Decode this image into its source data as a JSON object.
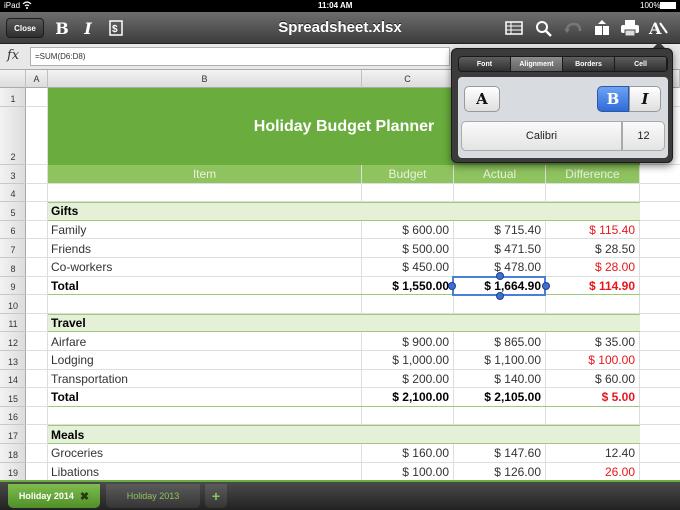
{
  "status": {
    "carrier": "iPad",
    "time": "11:04 AM",
    "battery": "100%"
  },
  "toolbar": {
    "close_label": "Close",
    "bold_label": "B",
    "italic_label": "I",
    "title": "Spreadsheet.xlsx",
    "icons": [
      "format-icon",
      "table-icon",
      "search-icon",
      "undo-icon",
      "insert-icon",
      "print-icon",
      "text-format-icon"
    ]
  },
  "formula": {
    "fx": "fx",
    "value": "=SUM(D6:D8)"
  },
  "columns": [
    "A",
    "B",
    "C"
  ],
  "rows": [
    "1",
    "2",
    "3",
    "4",
    "5",
    "6",
    "7",
    "8",
    "9",
    "10",
    "11",
    "12",
    "13",
    "14",
    "15",
    "16",
    "17",
    "18",
    "19"
  ],
  "sheet": {
    "title": "Holiday Budget Planner",
    "headers": {
      "item": "Item",
      "budget": "Budget",
      "actual": "Actual",
      "difference": "Difference"
    },
    "sections": [
      {
        "name": "Gifts",
        "rows": [
          {
            "item": "Family",
            "budget": "$ 600.00",
            "actual": "$ 715.40",
            "difference": "$ 115.40"
          },
          {
            "item": "Friends",
            "budget": "$ 500.00",
            "actual": "$ 471.50",
            "difference": "$ 28.50"
          },
          {
            "item": "Co-workers",
            "budget": "$ 450.00",
            "actual": "$ 478.00",
            "difference": "$ 28.00"
          }
        ],
        "total": {
          "item": "Total",
          "budget": "$ 1,550.00",
          "actual": "$ 1,664.90",
          "difference": "$ 114.90"
        }
      },
      {
        "name": "Travel",
        "rows": [
          {
            "item": "Airfare",
            "budget": "$ 900.00",
            "actual": "$ 865.00",
            "difference": "$ 35.00"
          },
          {
            "item": "Lodging",
            "budget": "$ 1,000.00",
            "actual": "$ 1,100.00",
            "difference": "$ 100.00"
          },
          {
            "item": "Transportation",
            "budget": "$ 200.00",
            "actual": "$ 140.00",
            "difference": "$ 60.00"
          }
        ],
        "total": {
          "item": "Total",
          "budget": "$ 2,100.00",
          "actual": "$ 2,105.00",
          "difference": "$ 5.00"
        }
      },
      {
        "name": "Meals",
        "rows": [
          {
            "item": "Groceries",
            "budget": "$ 160.00",
            "actual": "$ 147.60",
            "difference": "12.40"
          },
          {
            "item": "Libations",
            "budget": "$ 100.00",
            "actual": "$ 126.00",
            "difference": "26.00"
          }
        ]
      }
    ]
  },
  "popover": {
    "tabs": [
      "Font",
      "Alignment",
      "Borders",
      "Cell"
    ],
    "active_tab": "Font",
    "size_button": "A",
    "bold": "B",
    "italic": "I",
    "font_name": "Calibri",
    "font_size": "12"
  },
  "sheet_tabs": {
    "active": "Holiday 2014",
    "other": "Holiday 2013",
    "add": "+"
  },
  "colors": {
    "accent": "#6aac3d",
    "header_green": "#8ec35e",
    "negative_red": "#e8161c",
    "selection_blue": "#4a7fd9"
  }
}
